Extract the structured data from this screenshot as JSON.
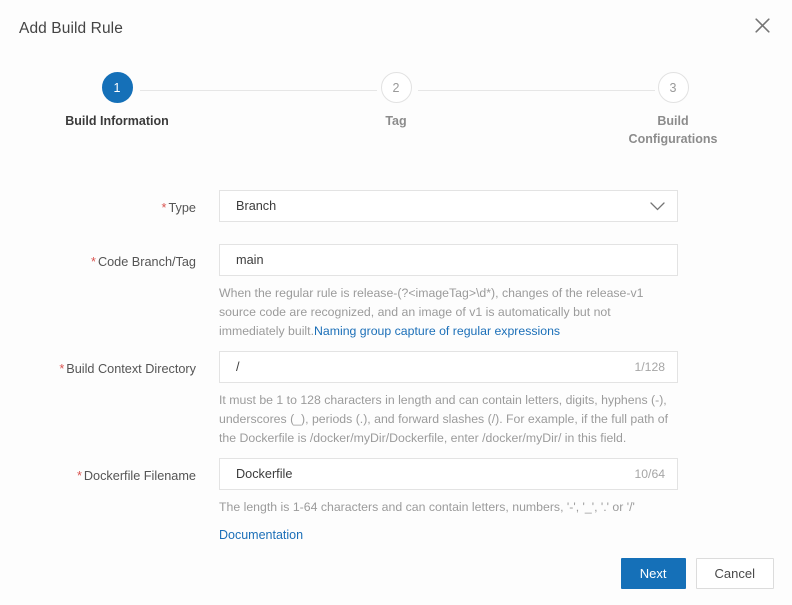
{
  "dialog": {
    "title": "Add Build Rule",
    "close_icon": "close-icon"
  },
  "stepper": {
    "steps": [
      {
        "number": "1",
        "label": "Build Information",
        "state": "active"
      },
      {
        "number": "2",
        "label": "Tag",
        "state": "inactive"
      },
      {
        "number": "3",
        "label": "Build Configurations",
        "state": "inactive"
      }
    ]
  },
  "form": {
    "required_marker": "*",
    "type": {
      "label": "Type",
      "value": "Branch",
      "icon": "chevron-down-icon"
    },
    "code_branch_tag": {
      "label": "Code Branch/Tag",
      "value": "main",
      "helper_text": "When the regular rule is release-(?<imageTag>\\d*), changes of the release-v1 source code are recognized, and an image of v1 is automatically but not immediately built.",
      "helper_link": "Naming group capture of regular expressions"
    },
    "build_context_directory": {
      "label": "Build Context Directory",
      "value": "/",
      "counter": "1/128",
      "helper_text": "It must be 1 to 128 characters in length and can contain letters, digits, hyphens (-), underscores (_), periods (.), and forward slashes (/). For example, if the full path of the Dockerfile is /docker/myDir/Dockerfile, enter /docker/myDir/ in this field."
    },
    "dockerfile_filename": {
      "label": "Dockerfile Filename",
      "value": "Dockerfile",
      "counter": "10/64",
      "helper_text": "The length is 1-64 characters and can contain letters, numbers, '-', '_', '.' or '/'",
      "documentation_link": "Documentation"
    }
  },
  "footer": {
    "next_label": "Next",
    "cancel_label": "Cancel"
  },
  "colors": {
    "accent": "#1570b8",
    "link": "#1b6fb8",
    "required": "#d9534f",
    "helper_text": "#9b9b9b"
  }
}
